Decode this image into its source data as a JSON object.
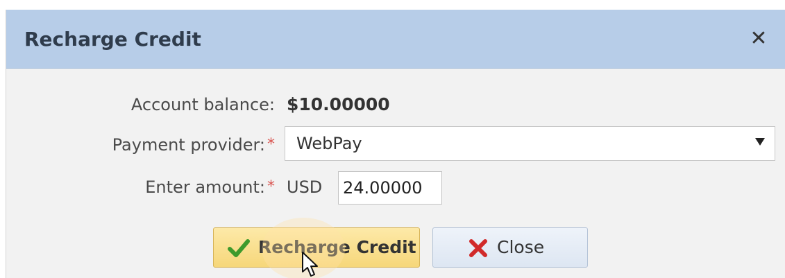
{
  "dialog": {
    "title": "Recharge Credit",
    "close_icon": "close-icon"
  },
  "form": {
    "balance_label": "Account balance:",
    "balance_value": "$10.00000",
    "provider_label": "Payment provider:",
    "provider_required": "*",
    "provider_selected": "WebPay",
    "amount_label": "Enter amount:",
    "amount_required": "*",
    "currency": "USD",
    "amount_value": "24.00000"
  },
  "buttons": {
    "recharge_label": "Recharge Credit",
    "recharge_icon": "checkmark-icon",
    "close_label": "Close",
    "close_icon": "red-x-icon"
  },
  "colors": {
    "titlebar": "#b7cde8",
    "required": "#d9534f",
    "primary_button": "#f6d77a",
    "secondary_button": "#dde6f2"
  }
}
